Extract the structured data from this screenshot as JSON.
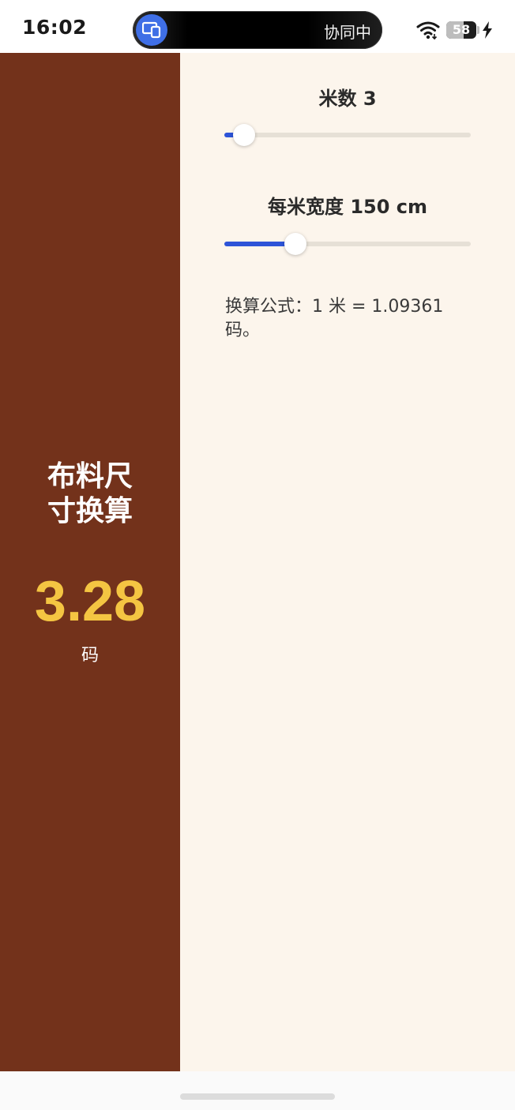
{
  "status_bar": {
    "time": "16:02",
    "collab_text": "协同中",
    "battery_level": "58",
    "battery_fraction": 0.58,
    "icons": [
      "devices-icon",
      "wifi-icon",
      "battery-icon",
      "charging-icon"
    ]
  },
  "left_panel": {
    "title": "布料尺寸换算",
    "result_value": "3.28",
    "result_unit": "码",
    "colors": {
      "background": "#73321b",
      "result": "#f4c542"
    }
  },
  "controls": {
    "meters": {
      "label": "米数 3",
      "fraction": 0.08
    },
    "width": {
      "label": "每米宽度 150 cm",
      "fraction": 0.29
    }
  },
  "formula": "换算公式：1 米 = 1.09361 码。",
  "colors": {
    "slider_active": "#2d54d8",
    "slider_track": "#e6e0d6",
    "panel_background": "#fcf5ec"
  }
}
